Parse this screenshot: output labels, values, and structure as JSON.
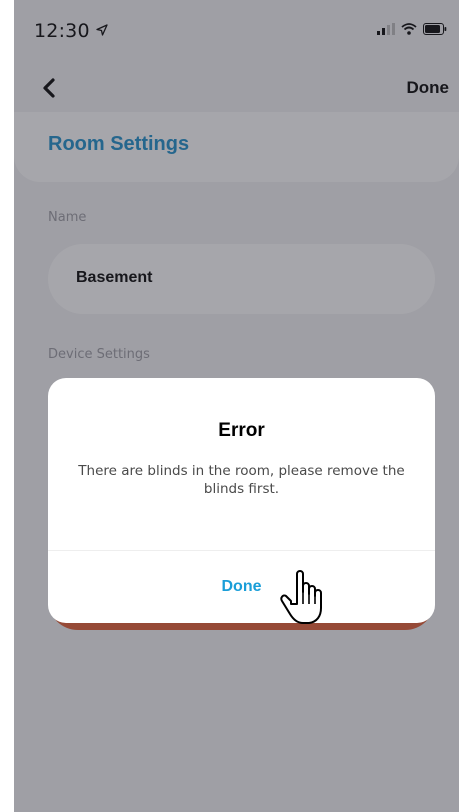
{
  "status_bar": {
    "time": "12:30",
    "location_icon": "location-arrow-icon",
    "signal_icon": "signal-icon",
    "wifi_icon": "wifi-icon",
    "battery_icon": "battery-icon"
  },
  "nav": {
    "back_icon": "chevron-left-icon",
    "done_label": "Done"
  },
  "page": {
    "title": "Room Settings"
  },
  "form": {
    "name_label": "Name",
    "name_value": "Basement",
    "device_settings_label": "Device Settings"
  },
  "dialog": {
    "title": "Error",
    "message": "There are blinds in the room, please remove the blinds first.",
    "done_label": "Done"
  },
  "colors": {
    "accent": "#1a8ec9",
    "dialog_button": "#1a9ed8",
    "device_card": "#e25c30",
    "background": "#f2f2f4"
  },
  "cursor_icon": "hand-pointer-icon"
}
